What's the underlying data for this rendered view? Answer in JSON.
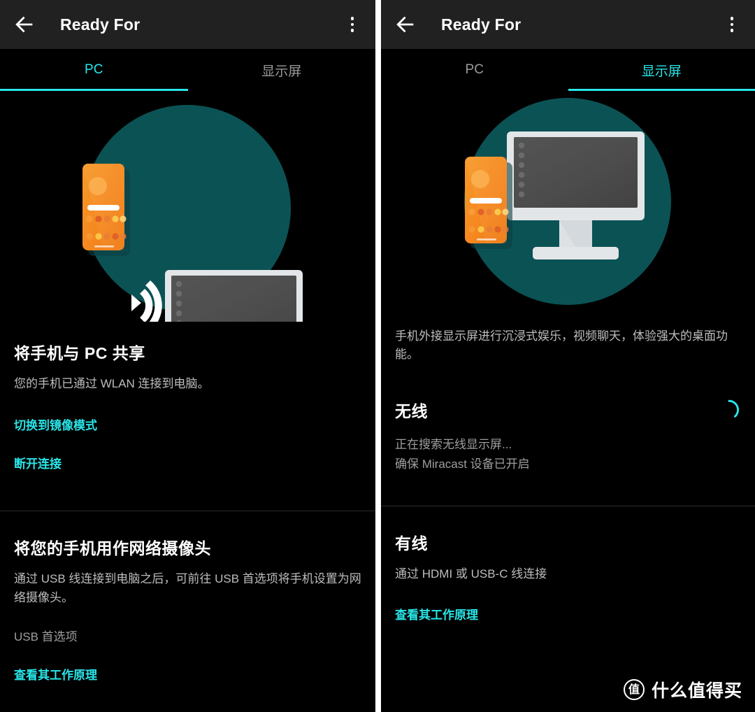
{
  "colors": {
    "accent_cyan": "#29E5E8",
    "appbar_bg": "#212121",
    "page_bg": "#000000",
    "illustration_circle_teal": "#0B5255",
    "phone_orange": "#F5881F",
    "device_light_grey": "#E3E6E8",
    "screen_dark_grey": "#4D4D4D",
    "body_text_grey": "#BDBDBD",
    "inactive_tab_grey": "#9A9A9A"
  },
  "left_panel": {
    "appbar": {
      "back_icon": "arrow-left-icon",
      "title": "Ready For",
      "overflow_icon": "more-vertical-icon"
    },
    "tabs": [
      {
        "label": "PC",
        "active": true
      },
      {
        "label": "显示屏",
        "active": false
      }
    ],
    "illustration": "phone-casting-to-laptop-illustration",
    "section_pc_share": {
      "title": "将手机与 PC 共享",
      "body": "您的手机已通过 WLAN 连接到电脑。",
      "link_switch_mirror": "切换到镜像模式",
      "link_disconnect": "断开连接"
    },
    "section_webcam": {
      "title": "将您的手机用作网络摄像头",
      "body": "通过 USB 线连接到电脑之后，可前往 USB 首选项将手机设置为网络摄像头。",
      "usb_pref_label": "USB 首选项",
      "link_how_it_works": "查看其工作原理"
    }
  },
  "right_panel": {
    "appbar": {
      "back_icon": "arrow-left-icon",
      "title": "Ready For",
      "overflow_icon": "more-vertical-icon"
    },
    "tabs": [
      {
        "label": "PC",
        "active": false
      },
      {
        "label": "显示屏",
        "active": true
      }
    ],
    "illustration": "phone-and-external-monitor-illustration",
    "intro_body": "手机外接显示屏进行沉浸式娱乐，视频聊天，体验强大的桌面功能。",
    "section_wireless": {
      "title": "无线",
      "status_line_1": "正在搜索无线显示屏...",
      "status_line_2": "确保 Miracast 设备已开启",
      "spinner": "loading-spinner-icon"
    },
    "section_wired": {
      "title": "有线",
      "body": "通过 HDMI 或 USB-C 线连接",
      "link_how_it_works": "查看其工作原理"
    }
  },
  "watermark": {
    "badge_glyph": "值",
    "text": "什么值得买"
  }
}
